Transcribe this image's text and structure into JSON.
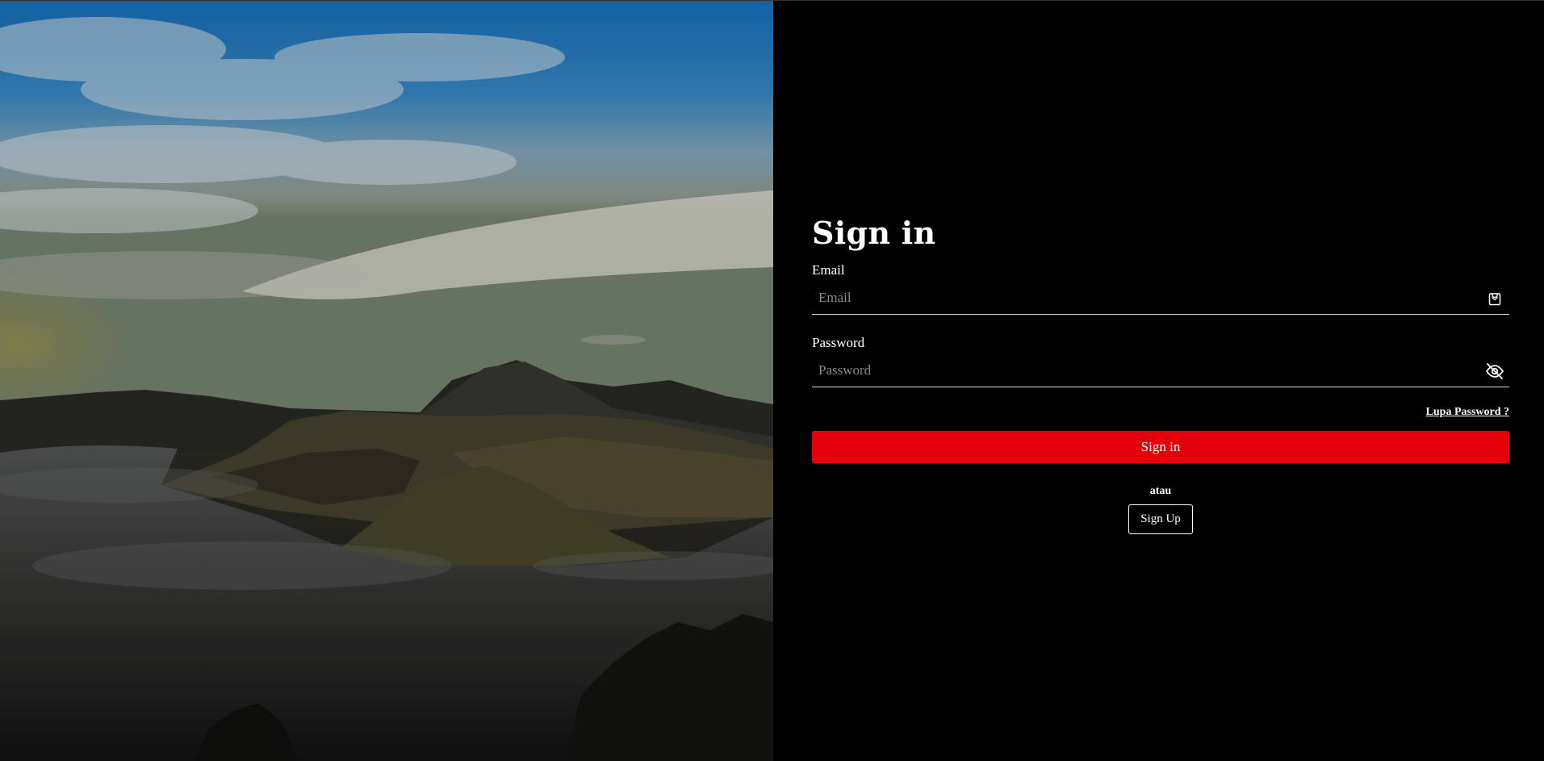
{
  "form": {
    "title": "Sign in",
    "email_label": "Email",
    "email_placeholder": "Email",
    "email_value": "",
    "password_label": "Password",
    "password_placeholder": "Password",
    "password_value": "",
    "forgot_link": "Lupa Password ?",
    "signin_button": "Sign in",
    "or_text": "atau",
    "signup_button": "Sign Up"
  },
  "icons": {
    "email_icon": "mail-icon",
    "password_icon": "eye-off-icon"
  },
  "colors": {
    "primary_button": "#e3000b",
    "panel_background": "#000000",
    "text": "#ffffff"
  }
}
